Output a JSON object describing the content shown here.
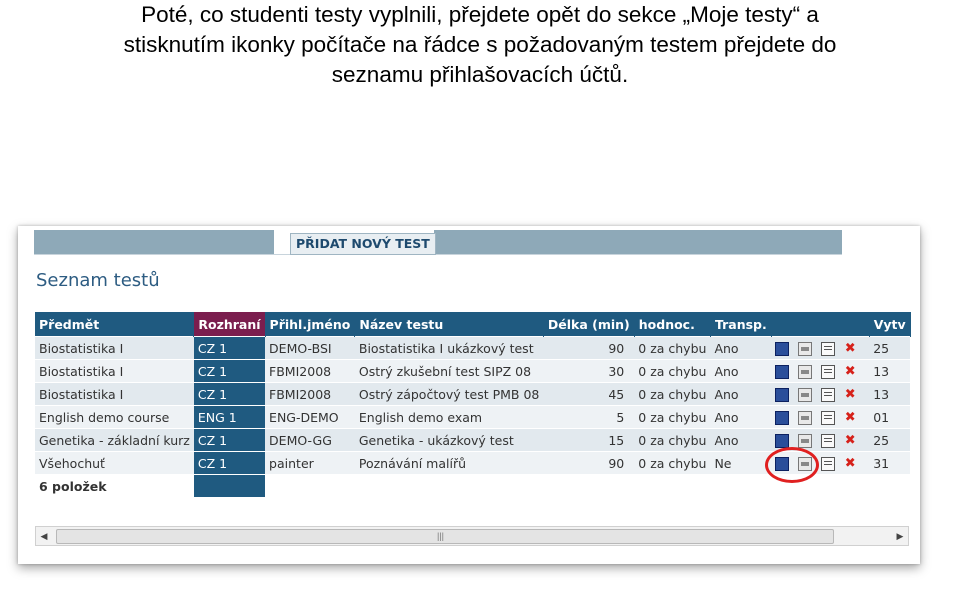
{
  "caption": {
    "line1": "Poté, co studenti testy vyplnili, přejdete opět do sekce „Moje testy“ a",
    "line2": "stisknutím ikonky počítače na řádce s požadovaným testem přejdete do",
    "line3": "seznamu přihlašovacích účtů."
  },
  "toolbar": {
    "add_test_label": "PŘIDAT NOVÝ TEST"
  },
  "list": {
    "title": "Seznam testů",
    "columns": [
      "Předmět",
      "Rozhraní",
      "Přihl.jméno",
      "Název testu",
      "Délka (min)",
      "hodnoc.",
      "Transp.",
      "",
      "Vytv"
    ],
    "rows": [
      {
        "subject": "Biostatistika I",
        "iface": "CZ 1",
        "login": "DEMO-BSI",
        "name": "Biostatistika I ukázkový test",
        "length": "90",
        "grading": "0 za chybu",
        "transp": "Ano",
        "extra": "25"
      },
      {
        "subject": "Biostatistika I",
        "iface": "CZ 1",
        "login": "FBMI2008",
        "name": "Ostrý zkušební test SIPZ 08",
        "length": "30",
        "grading": "0 za chybu",
        "transp": "Ano",
        "extra": "13"
      },
      {
        "subject": "Biostatistika I",
        "iface": "CZ 1",
        "login": "FBMI2008",
        "name": "Ostrý zápočtový test PMB 08",
        "length": "45",
        "grading": "0 za chybu",
        "transp": "Ano",
        "extra": "13"
      },
      {
        "subject": "English demo course",
        "iface": "ENG 1",
        "login": "ENG-DEMO",
        "name": "English demo exam",
        "length": "5",
        "grading": "0 za chybu",
        "transp": "Ano",
        "extra": "01"
      },
      {
        "subject": "Genetika - základní kurz",
        "iface": "CZ 1",
        "login": "DEMO-GG",
        "name": "Genetika - ukázkový test",
        "length": "15",
        "grading": "0 za chybu",
        "transp": "Ano",
        "extra": "25"
      },
      {
        "subject": "Všehochuť",
        "iface": "CZ 1",
        "login": "painter",
        "name": "Poznávání malířů",
        "length": "90",
        "grading": "0 za chybu",
        "transp": "Ne",
        "extra": "31"
      }
    ],
    "count_label": "6 položek"
  },
  "icons": [
    "computer-icon",
    "statistics-icon",
    "edit-icon",
    "delete-icon"
  ],
  "colors": {
    "header": "#1f5a80",
    "interface_header": "#7b1e4e",
    "highlight": "#e02020"
  }
}
